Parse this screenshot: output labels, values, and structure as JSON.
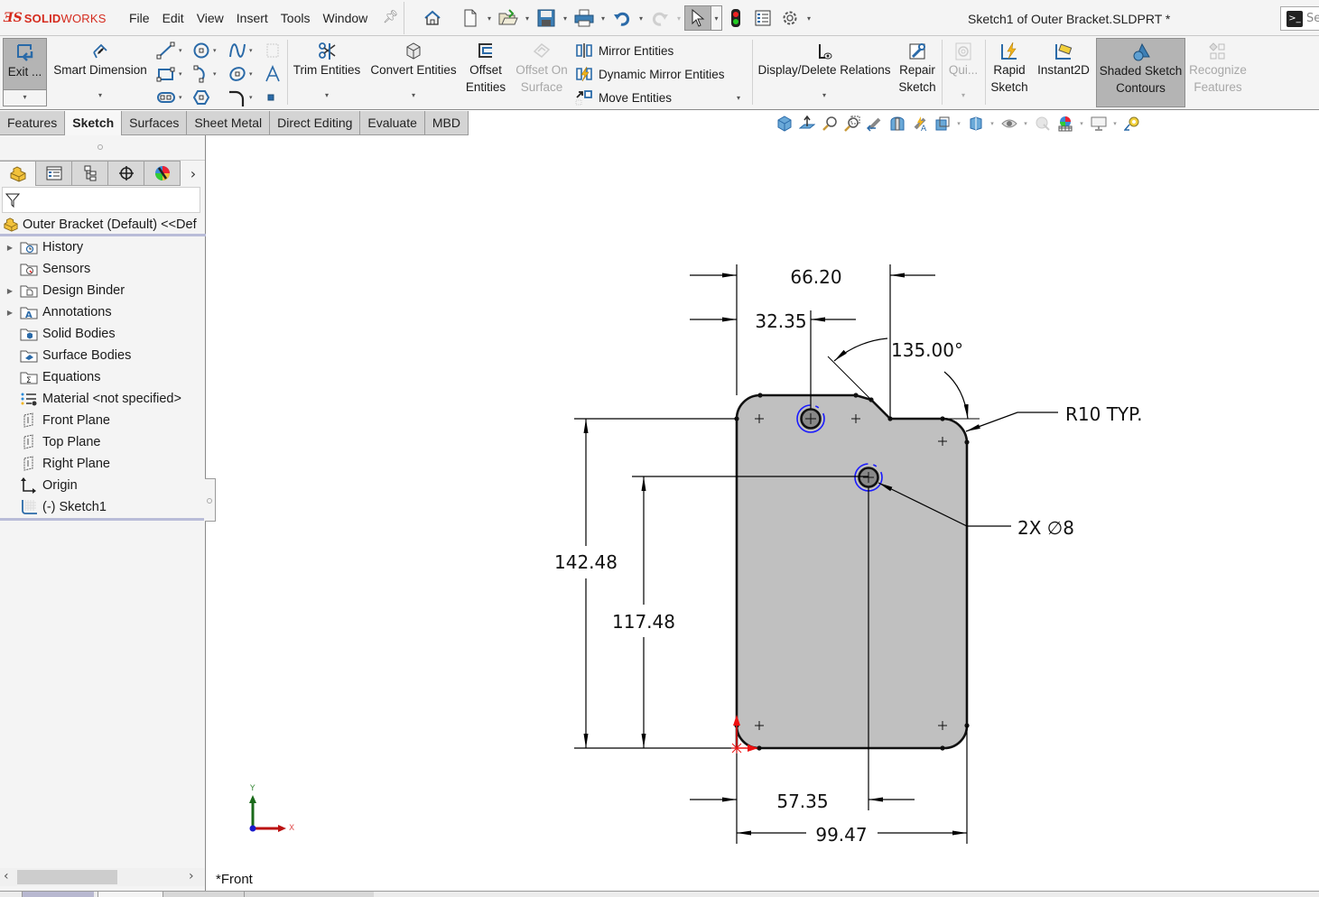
{
  "app": {
    "brand_prefix": "SOLID",
    "brand_suffix": "WORKS",
    "document_title": "Sketch1 of Outer Bracket.SLDPRT *",
    "search_placeholder": "Se"
  },
  "menu": [
    "File",
    "Edit",
    "View",
    "Insert",
    "Tools",
    "Window"
  ],
  "quick_access": [
    {
      "icon": "home-icon"
    },
    {
      "icon": "new-document-icon"
    },
    {
      "icon": "open-icon"
    },
    {
      "icon": "save-icon"
    },
    {
      "icon": "print-icon"
    },
    {
      "icon": "undo-icon"
    },
    {
      "icon": "redo-icon"
    },
    {
      "icon": "select-icon"
    },
    {
      "icon": "rebuild-icon"
    },
    {
      "icon": "file-properties-icon"
    },
    {
      "icon": "options-icon"
    }
  ],
  "command_manager": {
    "exit_sketch": "Exit ...",
    "smart_dimension": "Smart Dimension",
    "trim_entities": "Trim Entities",
    "convert_entities": "Convert Entities",
    "offset_entities": [
      "Offset",
      "Entities"
    ],
    "offset_on_surface": [
      "Offset On",
      "Surface"
    ],
    "mirror_entities": "Mirror Entities",
    "dynamic_mirror_entities": "Dynamic Mirror Entities",
    "move_entities": "Move Entities",
    "display_delete_relations": "Display/Delete Relations",
    "repair_sketch": [
      "Repair",
      "Sketch"
    ],
    "quick_snaps": "Qui...",
    "rapid_sketch": [
      "Rapid",
      "Sketch"
    ],
    "instant2d": "Instant2D",
    "shaded_sketch_contours": [
      "Shaded Sketch",
      "Contours"
    ],
    "recognize_features": [
      "Recognize",
      "Features"
    ]
  },
  "tabs": [
    {
      "label": "Features",
      "active": false
    },
    {
      "label": "Sketch",
      "active": true
    },
    {
      "label": "Surfaces",
      "active": false
    },
    {
      "label": "Sheet Metal",
      "active": false
    },
    {
      "label": "Direct Editing",
      "active": false
    },
    {
      "label": "Evaluate",
      "active": false
    },
    {
      "label": "MBD",
      "active": false
    }
  ],
  "feature_tree": {
    "root": "Outer Bracket (Default) <<Def",
    "items": [
      {
        "label": "History",
        "expandable": true,
        "icon": "history-folder-icon"
      },
      {
        "label": "Sensors",
        "expandable": false,
        "icon": "sensors-folder-icon"
      },
      {
        "label": "Design Binder",
        "expandable": true,
        "icon": "design-binder-icon"
      },
      {
        "label": "Annotations",
        "expandable": true,
        "icon": "annotations-icon"
      },
      {
        "label": "Solid Bodies",
        "expandable": false,
        "icon": "solid-bodies-icon"
      },
      {
        "label": "Surface Bodies",
        "expandable": false,
        "icon": "surface-bodies-icon"
      },
      {
        "label": "Equations",
        "expandable": false,
        "icon": "equations-icon"
      },
      {
        "label": "Material <not specified>",
        "expandable": false,
        "icon": "material-icon"
      },
      {
        "label": "Front Plane",
        "expandable": false,
        "icon": "plane-icon"
      },
      {
        "label": "Top Plane",
        "expandable": false,
        "icon": "plane-icon"
      },
      {
        "label": "Right Plane",
        "expandable": false,
        "icon": "plane-icon"
      },
      {
        "label": "Origin",
        "expandable": false,
        "icon": "origin-icon"
      },
      {
        "label": "(-) Sketch1",
        "expandable": false,
        "icon": "sketch-icon"
      }
    ]
  },
  "viewport": {
    "view_name": "*Front",
    "triad": {
      "x": "X",
      "y": "Y"
    },
    "dimensions": {
      "top_width": "66.20",
      "hole1_x": "32.35",
      "chamfer_angle": "135.00°",
      "fillet_note": "R10 TYP.",
      "hole_note": "2X ∅8",
      "overall_height": "142.48",
      "hole2_y": "117.48",
      "hole2_x": "57.35",
      "overall_width": "99.47"
    },
    "colors": {
      "part_fill": "#c0c0c0",
      "geometry": "#111111",
      "selection": "#1a1aff",
      "origin": "#ee1111"
    }
  }
}
